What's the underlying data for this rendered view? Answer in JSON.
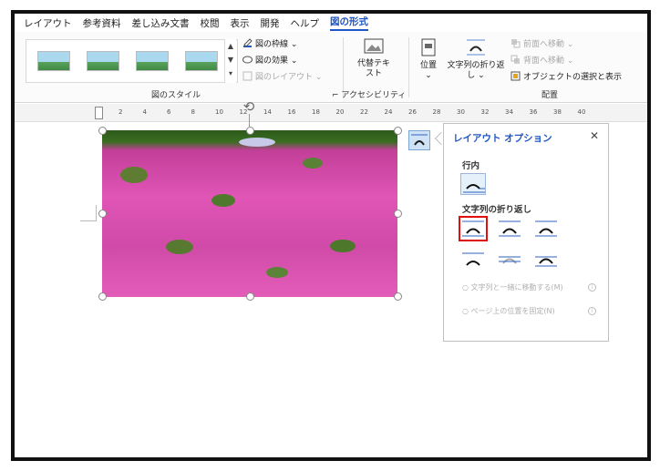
{
  "tabs": [
    "レイアウト",
    "参考資料",
    "差し込み文書",
    "校閲",
    "表示",
    "開発",
    "ヘルプ",
    "図の形式"
  ],
  "active_tab": "図の形式",
  "ribbon": {
    "picture_border": "図の枠線",
    "picture_effects": "図の効果",
    "picture_layout": "図のレイアウト",
    "group_picture_styles": "図のスタイル",
    "alt_text": "代替テキスト",
    "group_accessibility": "アクセシビリティ",
    "position": "位置",
    "wrap_text": "文字列の折り返し",
    "bring_forward": "前面へ移動",
    "send_backward": "背面へ移動",
    "selection_pane": "オブジェクトの選択と表示",
    "group_arrange": "配置"
  },
  "ruler_numbers": [
    "2",
    "4",
    "6",
    "8",
    "10",
    "12",
    "14",
    "16",
    "18",
    "20",
    "22",
    "24",
    "26",
    "28",
    "30",
    "32",
    "34",
    "36",
    "38",
    "40"
  ],
  "layout_pane": {
    "title": "レイアウト オプション",
    "close": "✕",
    "section_inline": "行内",
    "section_wrap": "文字列の折り返し",
    "opt_move_with_text": "文字列と一緒に移動する(M)",
    "opt_fix_position": "ページ上の位置を固定(N)"
  },
  "colors": {
    "accent": "#1f56c5",
    "highlight": "#e01010"
  }
}
